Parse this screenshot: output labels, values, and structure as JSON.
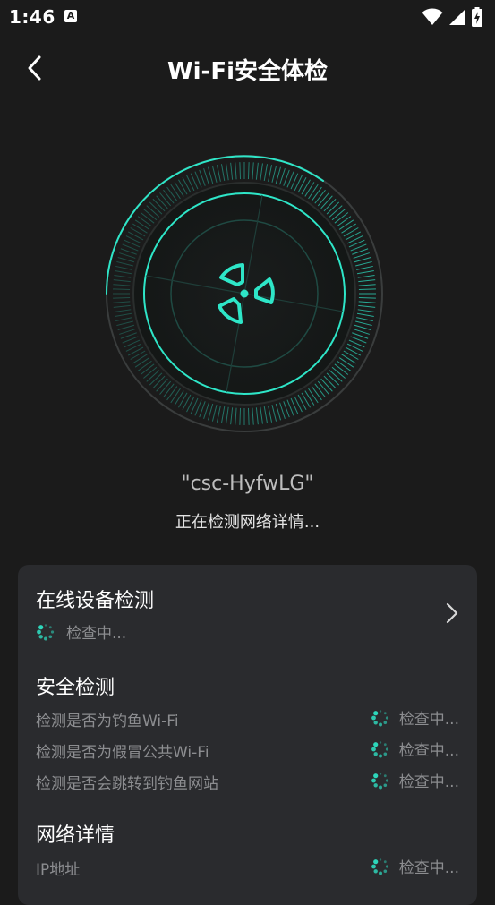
{
  "status_bar": {
    "time": "1:46",
    "notification_icon": "a-icon",
    "icons": [
      "wifi-icon",
      "signal-icon",
      "battery-charging-icon"
    ]
  },
  "header": {
    "title": "Wi-Fi安全体检",
    "back_icon": "back-arrow-icon"
  },
  "scan": {
    "ssid": "\"csc-HyfwLG\"",
    "status": "正在检测网络详情...",
    "center_icon": "fan-icon"
  },
  "colors": {
    "accent": "#2ee6c8",
    "background": "#1b1b1b",
    "card": "#2a2b2e",
    "muted_text": "#8c8d90"
  },
  "card": {
    "online_devices": {
      "title": "在线设备检测",
      "status": "检查中..."
    },
    "security": {
      "title": "安全检测",
      "rows": [
        {
          "label": "检测是否为钓鱼Wi-Fi",
          "status": "检查中..."
        },
        {
          "label": "检测是否为假冒公共Wi-Fi",
          "status": "检查中..."
        },
        {
          "label": "检测是否会跳转到钓鱼网站",
          "status": "检查中..."
        }
      ]
    },
    "network": {
      "title": "网络详情",
      "rows": [
        {
          "label": "IP地址",
          "status": "检查中..."
        }
      ]
    }
  }
}
